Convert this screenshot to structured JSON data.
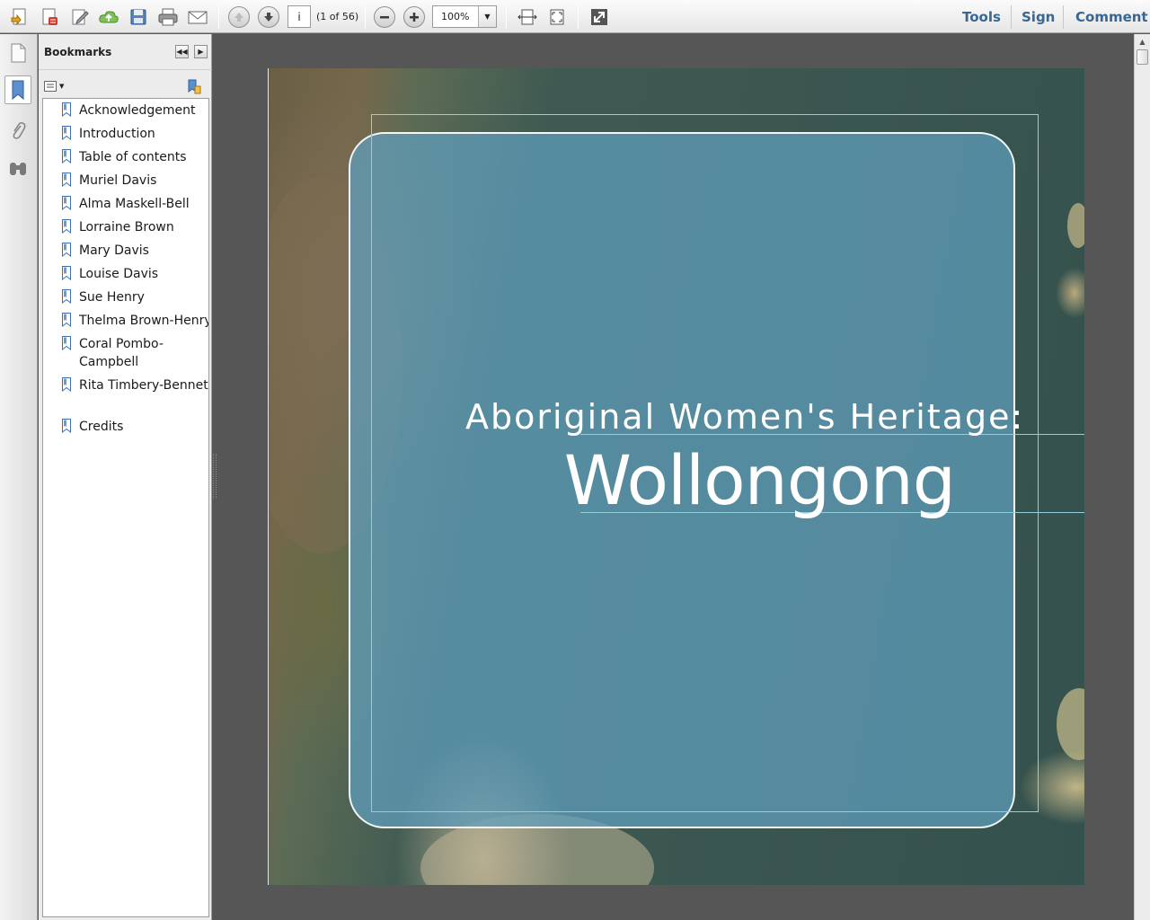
{
  "toolbar": {
    "page_input_value": "i",
    "page_count": "(1 of 56)",
    "zoom_value": "100%",
    "links": {
      "tools": "Tools",
      "sign": "Sign",
      "comment": "Comment"
    },
    "icons": [
      "create-pdf-icon",
      "convert-pdf-icon",
      "edit-icon",
      "upload-icon",
      "save-icon",
      "print-icon",
      "email-icon",
      "previous-page-icon",
      "next-page-icon",
      "zoom-out-icon",
      "zoom-in-icon",
      "fit-width-icon",
      "fit-page-icon",
      "fullscreen-icon"
    ],
    "accent_color": "#3a6690"
  },
  "sidebar": {
    "title": "Bookmarks",
    "strip_icons": [
      "page-thumbnails-icon",
      "bookmarks-icon",
      "attachments-icon",
      "search-binoculars-icon"
    ],
    "bookmarks": [
      "Acknowledgement",
      "Introduction",
      "Table of contents",
      "Muriel Davis",
      "Alma Maskell-Bell",
      "Lorraine Brown",
      "Mary Davis",
      "Louise Davis",
      "Sue Henry",
      "Thelma Brown-Henry",
      "Coral Pombo-Campbell",
      "Rita Timbery-Bennett",
      "Credits"
    ]
  },
  "document": {
    "subtitle": "Aboriginal Women's Heritage:",
    "title": "Wollongong",
    "overlay_color": "#60a0be",
    "frame_color": "#8fd0dc"
  }
}
